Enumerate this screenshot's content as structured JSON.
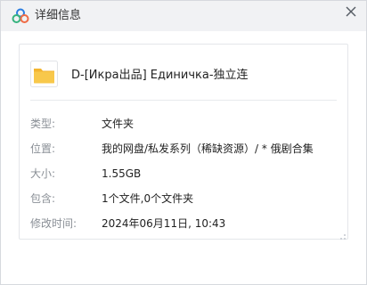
{
  "window": {
    "title": "详细信息",
    "icons": {
      "app": "cloud-logo-icon",
      "close": "close-icon"
    }
  },
  "file": {
    "name": "D-[Икра出品] Единичка-独立连",
    "icon": "folder-icon"
  },
  "details": [
    {
      "label": "类型:",
      "value": "文件夹"
    },
    {
      "label": "位置:",
      "value": "我的网盘/私发系列（稀缺资源）/ * 俄剧合集"
    },
    {
      "label": "大小:",
      "value": "1.55GB"
    },
    {
      "label": "包含:",
      "value": "1个文件,0个文件夹"
    },
    {
      "label": "修改时间:",
      "value": "2024年06月11日, 10:43"
    }
  ],
  "colors": {
    "titlebar": "#f1f2f4",
    "folder": "#f7c447",
    "label_text": "#8a8f96",
    "value_text": "#222222"
  }
}
